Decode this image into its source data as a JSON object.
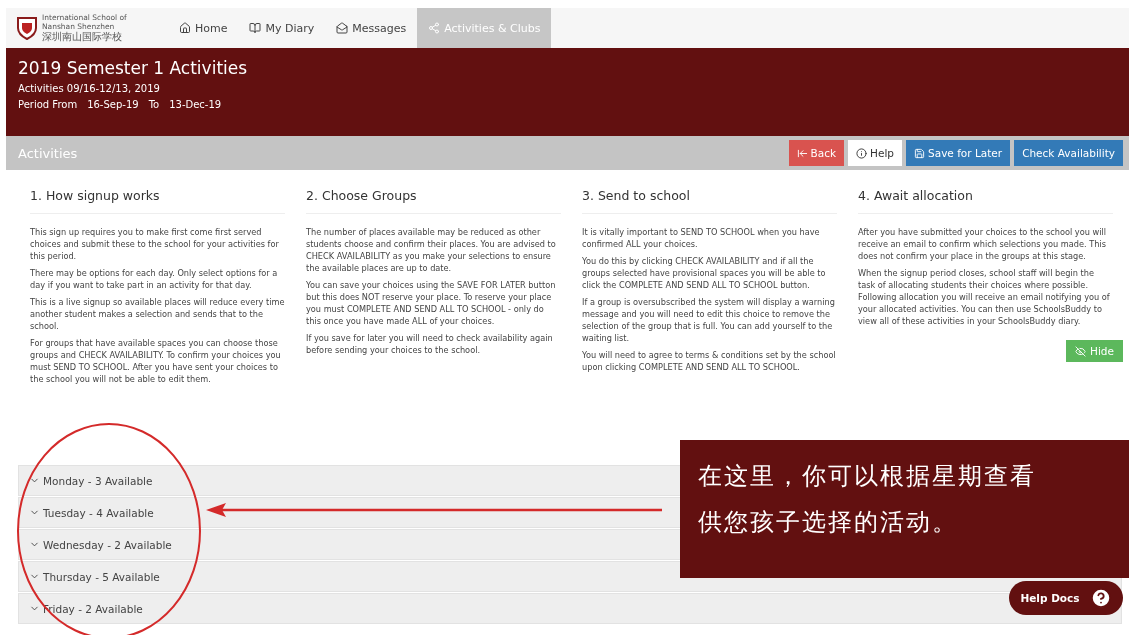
{
  "nav": {
    "school_name": "International School of Nanshan Shenzhen",
    "school_name_cn": "深圳南山国际学校",
    "items": [
      {
        "label": "Home",
        "selected": false
      },
      {
        "label": "My Diary",
        "selected": false
      },
      {
        "label": "Messages",
        "selected": false
      },
      {
        "label": "Activities & Clubs",
        "selected": true
      }
    ]
  },
  "header": {
    "title": "2019 Semester 1 Activities",
    "subtitle": "Activities 09/16-12/13, 2019",
    "period_label": "Period From",
    "from": "16-Sep-19",
    "to_label": "To",
    "to": "13-Dec-19"
  },
  "toolbar": {
    "title": "Activities",
    "buttons": [
      {
        "label": "Back",
        "kind": "danger"
      },
      {
        "label": "Help",
        "kind": "default"
      },
      {
        "label": "Save for Later",
        "kind": "primary"
      },
      {
        "label": "Check Availability",
        "kind": "primary"
      }
    ]
  },
  "steps": [
    {
      "title": "1. How signup works",
      "paragraphs": [
        "This sign up requires you to make first come first served choices and submit these to the school for your activities for this period.",
        "There may be options for each day. Only select options for a day if you want to take part in an activity for that day.",
        "This is a live signup so available places will reduce every time another student makes a selection and sends that to the school.",
        "For groups that have available spaces you can choose those groups and CHECK AVAILABILITY. To confirm your choices you must SEND TO SCHOOL. After you have sent your choices to the school you will not be able to edit them."
      ]
    },
    {
      "title": "2. Choose Groups",
      "paragraphs": [
        "The number of places available may be reduced as other students choose and confirm their places. You are advised to CHECK AVAILABILITY as you make your selections to ensure the available places are up to date.",
        "You can save your choices using the SAVE FOR LATER button but this does NOT reserve your place. To reserve your place you must COMPLETE AND SEND ALL TO SCHOOL - only do this once you have made ALL of your choices.",
        "If you save for later you will need to check availability again before sending your choices to the school."
      ]
    },
    {
      "title": "3. Send to school",
      "paragraphs": [
        "It is vitally important to SEND TO SCHOOL when you have confirmed ALL your choices.",
        "You do this by clicking CHECK AVAILABILITY and if all the groups selected have provisional spaces you will be able to click the COMPLETE AND SEND ALL TO SCHOOL button.",
        "If a group is oversubscribed the system will display a warning message and you will need to edit this choice to remove the selection of the group that is full. You can add yourself to the waiting list.",
        "You will need to agree to terms & conditions set by the school upon clicking COMPLETE AND SEND ALL TO SCHOOL."
      ]
    },
    {
      "title": "4. Await allocation",
      "paragraphs": [
        "After you have submitted your choices to the school you will receive an email to confirm which selections you made. This does not confirm your place in the groups at this stage.",
        "When the signup period closes, school staff will begin the task of allocating students their choices where possible. Following allocation you will receive an email notifying you of your allocated activities. You can then use SchoolsBuddy to view all of these activities in your SchoolsBuddy diary."
      ]
    }
  ],
  "hide_button": "Hide",
  "days": [
    {
      "label": "Monday - 3 Available",
      "expanded": false
    },
    {
      "label": "Tuesday - 4 Available",
      "expanded": false
    },
    {
      "label": "Wednesday - 2 Available",
      "expanded": false
    },
    {
      "label": "Thursday - 5 Available",
      "expanded": false
    },
    {
      "label": "Friday - 2 Available",
      "expanded": false
    }
  ],
  "callout": {
    "lines": [
      "在这里，你可以根据星期查看",
      "供您孩子选择的活动。"
    ]
  },
  "help_docs": "Help Docs"
}
